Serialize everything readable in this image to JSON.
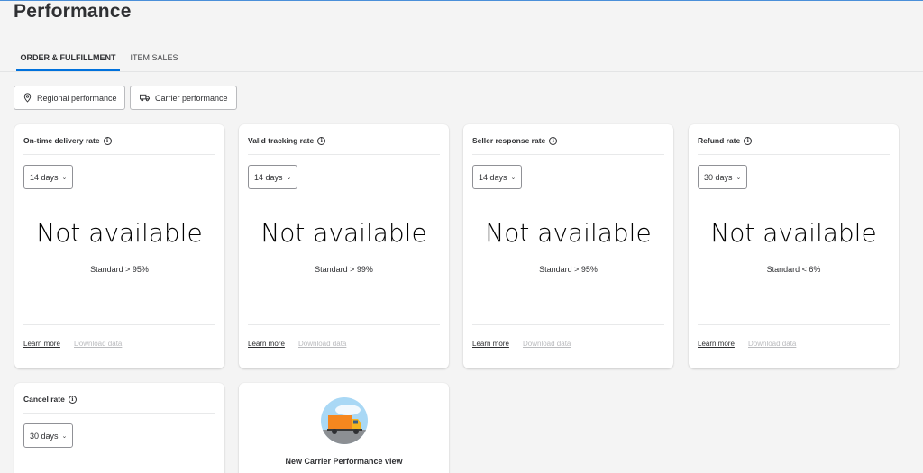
{
  "page": {
    "title": "Performance"
  },
  "tabs": [
    {
      "label": "ORDER & FULFILLMENT",
      "active": true
    },
    {
      "label": "ITEM SALES",
      "active": false
    }
  ],
  "filters": {
    "regional": "Regional performance",
    "carrier": "Carrier performance"
  },
  "cards": [
    {
      "title": "On-time delivery rate",
      "period": "14 days",
      "value": "Not available",
      "standard": "Standard > 95%",
      "learn_more": "Learn more",
      "download": "Download data"
    },
    {
      "title": "Valid tracking rate",
      "period": "14 days",
      "value": "Not available",
      "standard": "Standard > 99%",
      "learn_more": "Learn more",
      "download": "Download data"
    },
    {
      "title": "Seller response rate",
      "period": "14 days",
      "value": "Not available",
      "standard": "Standard > 95%",
      "learn_more": "Learn more",
      "download": "Download data"
    },
    {
      "title": "Refund rate",
      "period": "30 days",
      "value": "Not available",
      "standard": "Standard < 6%",
      "learn_more": "Learn more",
      "download": "Download data"
    },
    {
      "title": "Cancel rate",
      "period": "30 days"
    }
  ],
  "promo": {
    "title": "New Carrier Performance view"
  },
  "colors": {
    "accent": "#0071dc",
    "truck": "#f5871f",
    "sky": "#a9d8f5"
  }
}
